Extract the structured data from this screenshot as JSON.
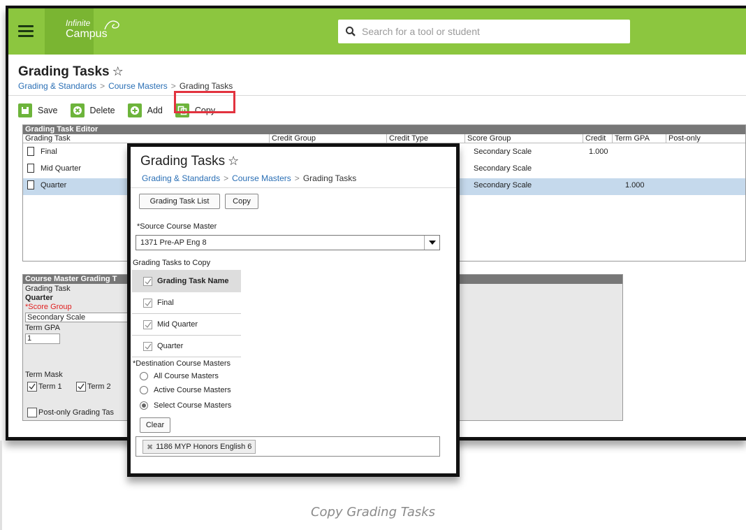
{
  "app": {
    "logo_line1": "Infinite",
    "logo_line2": "Campus",
    "search_placeholder": "Search for a tool or student",
    "brand_color": "#8cc63f"
  },
  "page": {
    "title": "Grading Tasks",
    "breadcrumb": [
      "Grading & Standards",
      "Course Masters",
      "Grading Tasks"
    ]
  },
  "toolbar": {
    "save_label": "Save",
    "delete_label": "Delete",
    "add_label": "Add",
    "copy_label": "Copy"
  },
  "editor": {
    "header": "Grading Task Editor",
    "columns": [
      "Grading Task",
      "Credit Group",
      "Credit Type",
      "Score Group",
      "Credit",
      "Term GPA",
      "Post-only"
    ],
    "rows": [
      {
        "task": "Final",
        "score_group": "Secondary Scale",
        "credit": "1.000",
        "term_gpa": ""
      },
      {
        "task": "Mid Quarter",
        "score_group": "Secondary Scale",
        "credit": "",
        "term_gpa": ""
      },
      {
        "task": "Quarter",
        "score_group": "Secondary Scale",
        "credit": "",
        "term_gpa": "1.000"
      }
    ]
  },
  "course_master_panel": {
    "header": "Course Master Grading T",
    "grading_task_label": "Grading Task",
    "grading_task_value": "Quarter",
    "score_group_label": "*Score Group",
    "score_group_value": "Secondary Scale",
    "term_gpa_label": "Term GPA",
    "term_gpa_value": "1",
    "term_mask_label": "Term Mask",
    "term1": "Term 1",
    "term2": "Term 2",
    "post_only_label": "Post-only Grading Tas"
  },
  "dialog": {
    "title": "Grading Tasks",
    "breadcrumb": [
      "Grading & Standards",
      "Course Masters",
      "Grading Tasks"
    ],
    "list_button": "Grading Task List",
    "copy_button": "Copy",
    "source_label": "*Source Course Master",
    "source_value": "1371 Pre-AP Eng 8",
    "tasks_to_copy_label": "Grading Tasks to Copy",
    "table_header": "Grading Task Name",
    "tasks": [
      "Final",
      "Mid Quarter",
      "Quarter"
    ],
    "destination_label": "*Destination Course Masters",
    "destination_options": [
      "All Course Masters",
      "Active Course Masters",
      "Select Course Masters"
    ],
    "selected_option": "Select Course Masters",
    "clear_button": "Clear",
    "selected_tag": "1186 MYP Honors English 6"
  },
  "caption": "Copy Grading Tasks"
}
